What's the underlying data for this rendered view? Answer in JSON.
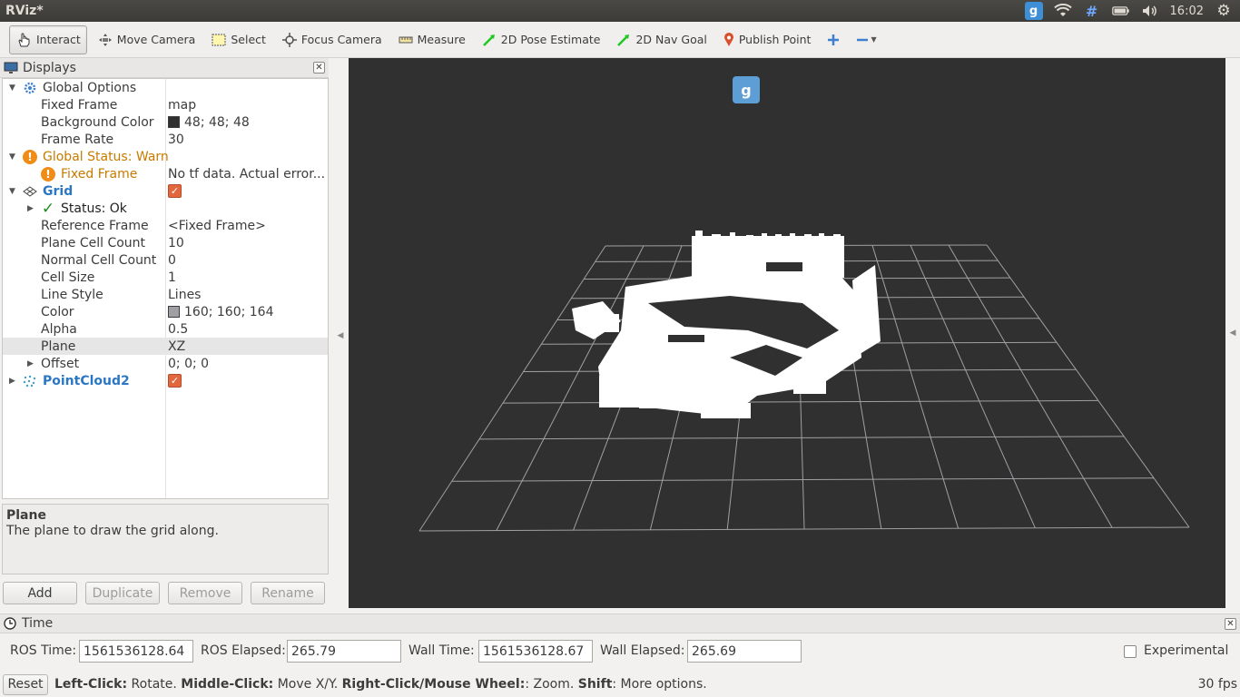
{
  "window": {
    "title": "RViz*"
  },
  "system": {
    "time": "16:02"
  },
  "toolbar": {
    "tools": [
      {
        "id": "interact",
        "label": "Interact",
        "icon": "hand-icon",
        "active": true
      },
      {
        "id": "move-camera",
        "label": "Move Camera",
        "icon": "move-camera-icon"
      },
      {
        "id": "select",
        "label": "Select",
        "icon": "select-icon"
      },
      {
        "id": "focus-camera",
        "label": "Focus Camera",
        "icon": "focus-camera-icon"
      },
      {
        "id": "measure",
        "label": "Measure",
        "icon": "measure-icon"
      },
      {
        "id": "pose-estimate",
        "label": "2D Pose Estimate",
        "icon": "green-arrow-icon"
      },
      {
        "id": "nav-goal",
        "label": "2D Nav Goal",
        "icon": "green-arrow-icon"
      },
      {
        "id": "publish-point",
        "label": "Publish Point",
        "icon": "map-pin-icon"
      }
    ]
  },
  "displays": {
    "title": "Displays",
    "rows": [
      {
        "label": "Global Options",
        "value": ""
      },
      {
        "label": "Fixed Frame",
        "value": "map"
      },
      {
        "label": "Background Color",
        "value": "48; 48; 48",
        "swatch": "#303030"
      },
      {
        "label": "Frame Rate",
        "value": "30"
      },
      {
        "label": "Global Status: Warn",
        "value": ""
      },
      {
        "label": "Fixed Frame",
        "value": "No tf data.  Actual error..."
      },
      {
        "label": "Grid",
        "value": ""
      },
      {
        "label": "Status: Ok",
        "value": ""
      },
      {
        "label": "Reference Frame",
        "value": "<Fixed Frame>"
      },
      {
        "label": "Plane Cell Count",
        "value": "10"
      },
      {
        "label": "Normal Cell Count",
        "value": "0"
      },
      {
        "label": "Cell Size",
        "value": "1"
      },
      {
        "label": "Line Style",
        "value": "Lines"
      },
      {
        "label": "Color",
        "value": "160; 160; 164",
        "swatch": "#a0a0a4"
      },
      {
        "label": "Alpha",
        "value": "0.5"
      },
      {
        "label": "Plane",
        "value": "XZ"
      },
      {
        "label": "Offset",
        "value": "0; 0; 0"
      },
      {
        "label": "PointCloud2",
        "value": ""
      }
    ],
    "description": {
      "title": "Plane",
      "text": "The plane to draw the grid along."
    },
    "buttons": {
      "add": "Add",
      "duplicate": "Duplicate",
      "remove": "Remove",
      "rename": "Rename"
    }
  },
  "viewport": {
    "background": "#303030",
    "grid_color": "#a0a0a4",
    "points_color": "#ffffff"
  },
  "time": {
    "title": "Time",
    "ros_time_label": "ROS Time:",
    "ros_time": "1561536128.64",
    "ros_elapsed_label": "ROS Elapsed:",
    "ros_elapsed": "265.79",
    "wall_time_label": "Wall Time:",
    "wall_time": "1561536128.67",
    "wall_elapsed_label": "Wall Elapsed:",
    "wall_elapsed": "265.69",
    "experimental_label": "Experimental"
  },
  "status": {
    "reset": "Reset",
    "left_click": "Left-Click:",
    "left_click_text": " Rotate. ",
    "middle_click": "Middle-Click:",
    "middle_click_text": " Move X/Y. ",
    "right_click": "Right-Click/Mouse Wheel:",
    "right_click_text": ": Zoom. ",
    "shift": "Shift",
    "shift_text": ": More options.",
    "fps": "30 fps"
  }
}
